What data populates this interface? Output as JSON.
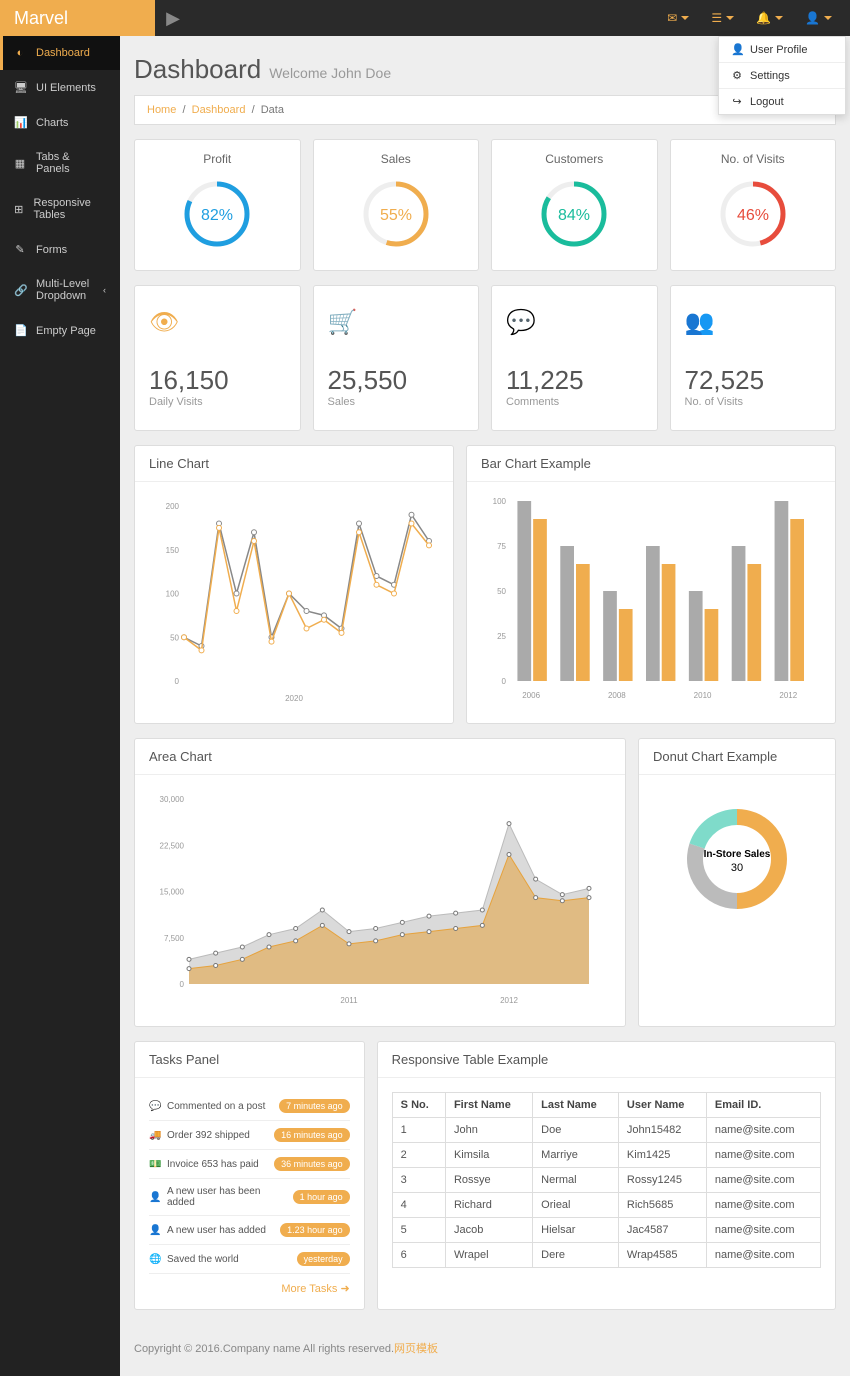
{
  "brand": "Marvel",
  "topnav_icons": [
    "envelope",
    "list",
    "bell",
    "user"
  ],
  "dropdown": [
    {
      "icon": "user",
      "label": "User Profile"
    },
    {
      "icon": "gear",
      "label": "Settings"
    },
    {
      "icon": "logout",
      "label": "Logout"
    }
  ],
  "sidebar": [
    {
      "icon": "gauge",
      "label": "Dashboard",
      "active": true
    },
    {
      "icon": "desktop",
      "label": "UI Elements"
    },
    {
      "icon": "bar",
      "label": "Charts"
    },
    {
      "icon": "table",
      "label": "Tabs & Panels"
    },
    {
      "icon": "grid",
      "label": "Responsive Tables"
    },
    {
      "icon": "edit",
      "label": "Forms"
    },
    {
      "icon": "sitemap",
      "label": "Multi-Level Dropdown",
      "caret": true
    },
    {
      "icon": "file",
      "label": "Empty Page"
    }
  ],
  "page": {
    "title": "Dashboard",
    "subtitle": "Welcome John Doe"
  },
  "breadcrumb": [
    "Home",
    "Dashboard",
    "Data"
  ],
  "rings": [
    {
      "label": "Profit",
      "pct": 82,
      "color": "#1f9ee0"
    },
    {
      "label": "Sales",
      "pct": 55,
      "color": "#f0ad4e"
    },
    {
      "label": "Customers",
      "pct": 84,
      "color": "#1abc9c"
    },
    {
      "label": "No. of Visits",
      "pct": 46,
      "color": "#e74c3c"
    }
  ],
  "stats": [
    {
      "icon": "eye",
      "value": "16,150",
      "label": "Daily Visits"
    },
    {
      "icon": "cart",
      "value": "25,550",
      "label": "Sales"
    },
    {
      "icon": "comments",
      "value": "11,225",
      "label": "Comments"
    },
    {
      "icon": "users",
      "value": "72,525",
      "label": "No. of Visits"
    }
  ],
  "chart_data": [
    {
      "type": "line",
      "title": "Line Chart",
      "x": [
        "",
        "",
        "",
        "",
        "",
        "",
        "",
        "",
        "2020",
        "",
        "",
        "",
        "",
        "",
        ""
      ],
      "series": [
        {
          "name": "a",
          "color": "#888",
          "values": [
            50,
            40,
            180,
            100,
            170,
            50,
            100,
            80,
            75,
            60,
            180,
            120,
            110,
            190,
            160
          ]
        },
        {
          "name": "b",
          "color": "#f0ad4e",
          "values": [
            50,
            35,
            175,
            80,
            160,
            45,
            100,
            60,
            70,
            55,
            170,
            110,
            100,
            180,
            155
          ]
        }
      ],
      "ylim": [
        0,
        200
      ]
    },
    {
      "type": "bar",
      "title": "Bar Chart Example",
      "categories": [
        "2006",
        "",
        "2008",
        "",
        "2010",
        "",
        "2012"
      ],
      "series": [
        {
          "name": "a",
          "color": "#aaa",
          "values": [
            100,
            75,
            50,
            75,
            50,
            75,
            100
          ]
        },
        {
          "name": "b",
          "color": "#f0ad4e",
          "values": [
            90,
            65,
            40,
            65,
            40,
            65,
            90
          ]
        }
      ],
      "ylim": [
        0,
        100
      ]
    },
    {
      "type": "area",
      "title": "Area Chart",
      "x": [
        "",
        "",
        "",
        "",
        "",
        "",
        "2011",
        "",
        "",
        "",
        "",
        "",
        "2012",
        "",
        "",
        ""
      ],
      "series": [
        {
          "name": "upper",
          "color": "#bbb",
          "values": [
            4000,
            5000,
            6000,
            8000,
            9000,
            12000,
            8500,
            9000,
            10000,
            11000,
            11500,
            12000,
            26000,
            17000,
            14500,
            15500
          ]
        },
        {
          "name": "lower",
          "color": "#e6a23c",
          "values": [
            2500,
            3000,
            4000,
            6000,
            7000,
            9500,
            6500,
            7000,
            8000,
            8500,
            9000,
            9500,
            21000,
            14000,
            13500,
            14000
          ]
        }
      ],
      "ylim": [
        0,
        30000
      ]
    },
    {
      "type": "pie",
      "title": "Donut Chart Example",
      "center_label": "In-Store Sales",
      "center_value": 30,
      "series": [
        {
          "name": "a",
          "value": 50,
          "color": "#f0ad4e"
        },
        {
          "name": "b",
          "value": 30,
          "color": "#bbb"
        },
        {
          "name": "c",
          "value": 20,
          "color": "#7fdbca"
        }
      ]
    }
  ],
  "tasks": {
    "title": "Tasks Panel",
    "more": "More Tasks",
    "items": [
      {
        "icon": "comment",
        "text": "Commented on a post",
        "badge": "7 minutes ago"
      },
      {
        "icon": "truck",
        "text": "Order 392 shipped",
        "badge": "16 minutes ago"
      },
      {
        "icon": "money",
        "text": "Invoice 653 has paid",
        "badge": "36 minutes ago"
      },
      {
        "icon": "user",
        "text": "A new user has been added",
        "badge": "1 hour ago"
      },
      {
        "icon": "user",
        "text": "A new user has added",
        "badge": "1.23 hour ago"
      },
      {
        "icon": "globe",
        "text": "Saved the world",
        "badge": "yesterday"
      }
    ]
  },
  "table": {
    "title": "Responsive Table Example",
    "cols": [
      "S No.",
      "First Name",
      "Last Name",
      "User Name",
      "Email ID."
    ],
    "rows": [
      [
        "1",
        "John",
        "Doe",
        "John15482",
        "name@site.com"
      ],
      [
        "2",
        "Kimsila",
        "Marriye",
        "Kim1425",
        "name@site.com"
      ],
      [
        "3",
        "Rossye",
        "Nermal",
        "Rossy1245",
        "name@site.com"
      ],
      [
        "4",
        "Richard",
        "Orieal",
        "Rich5685",
        "name@site.com"
      ],
      [
        "5",
        "Jacob",
        "Hielsar",
        "Jac4587",
        "name@site.com"
      ],
      [
        "6",
        "Wrapel",
        "Dere",
        "Wrap4585",
        "name@site.com"
      ]
    ]
  },
  "footer": {
    "text": "Copyright © 2016.Company name All rights reserved.",
    "link": "网页模板"
  }
}
